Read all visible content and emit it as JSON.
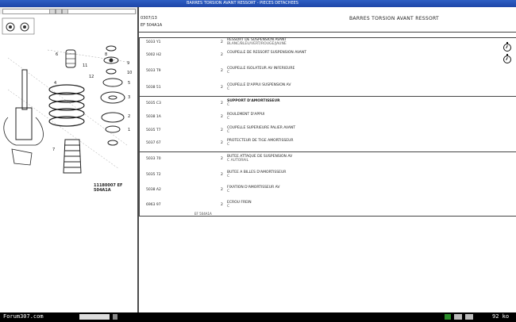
{
  "window": {
    "title": "BARRES TORSION AVANT RESSORT - PIECES DETACHEES"
  },
  "header": {
    "code1": "0307/13",
    "code2": "EF 504A1A",
    "title": "BARRES TORSION AVANT RESSORT"
  },
  "diagram": {
    "callouts": [
      "6",
      "4",
      "8",
      "9",
      "10",
      "11",
      "12",
      "5",
      "3",
      "2",
      "1",
      "7"
    ],
    "ref_code": "11180007  EF 504A1A"
  },
  "table": {
    "rows": [
      {
        "ref": "5033 Y1",
        "qty": "2",
        "desc": "RESSORT DE SUSPENSION AVANT",
        "sub": "BLANC/BLEU/VERT/ROUGE/JAUNE"
      },
      {
        "ref": "5002 H2",
        "qty": "2",
        "desc": "COUPELLE DE RESSORT SUSPENSION AVANT",
        "sub": ""
      },
      {
        "ref": "5033 T9",
        "qty": "2",
        "desc": "COUPELLE ISOLATEUR AV INFERIEURE",
        "sub": "C"
      },
      {
        "ref": "5038 51",
        "qty": "2",
        "desc": "COUPELLE D'APPUI SUSPENSION AV",
        "sub": "C"
      },
      {
        "ref": "5035 C3",
        "qty": "2",
        "desc": "SUPPORT D'AMORTISSEUR",
        "sub": "C"
      },
      {
        "ref": "5038 1A",
        "qty": "2",
        "desc": "ROULEMENT D'APPUI",
        "sub": "C"
      },
      {
        "ref": "5035 T7",
        "qty": "2",
        "desc": "COUPELLE SUPERIEURE PALIER AVANT",
        "sub": "C"
      },
      {
        "ref": "5037 67",
        "qty": "2",
        "desc": "PROTECTEUR DE TIGE AMORTISSEUR",
        "sub": "C"
      },
      {
        "ref": "5033 70",
        "qty": "2",
        "desc": "BUTEE ATTAQUE DE SUSPENSION AV",
        "sub": "C AUTORAIL"
      },
      {
        "ref": "5035 72",
        "qty": "2",
        "desc": "BUTEE A BILLES D'AMORTISSEUR",
        "sub": "C"
      },
      {
        "ref": "5038 A2",
        "qty": "2",
        "desc": "FIXATION D'AMORTISSEUR AV",
        "sub": "C"
      },
      {
        "ref": "6963 97",
        "qty": "2",
        "desc": "ECROU FREIN",
        "sub": "C"
      }
    ],
    "footnote": "EF 504A1A"
  },
  "status": {
    "site": "Forum307.com",
    "size": "92 ko"
  }
}
